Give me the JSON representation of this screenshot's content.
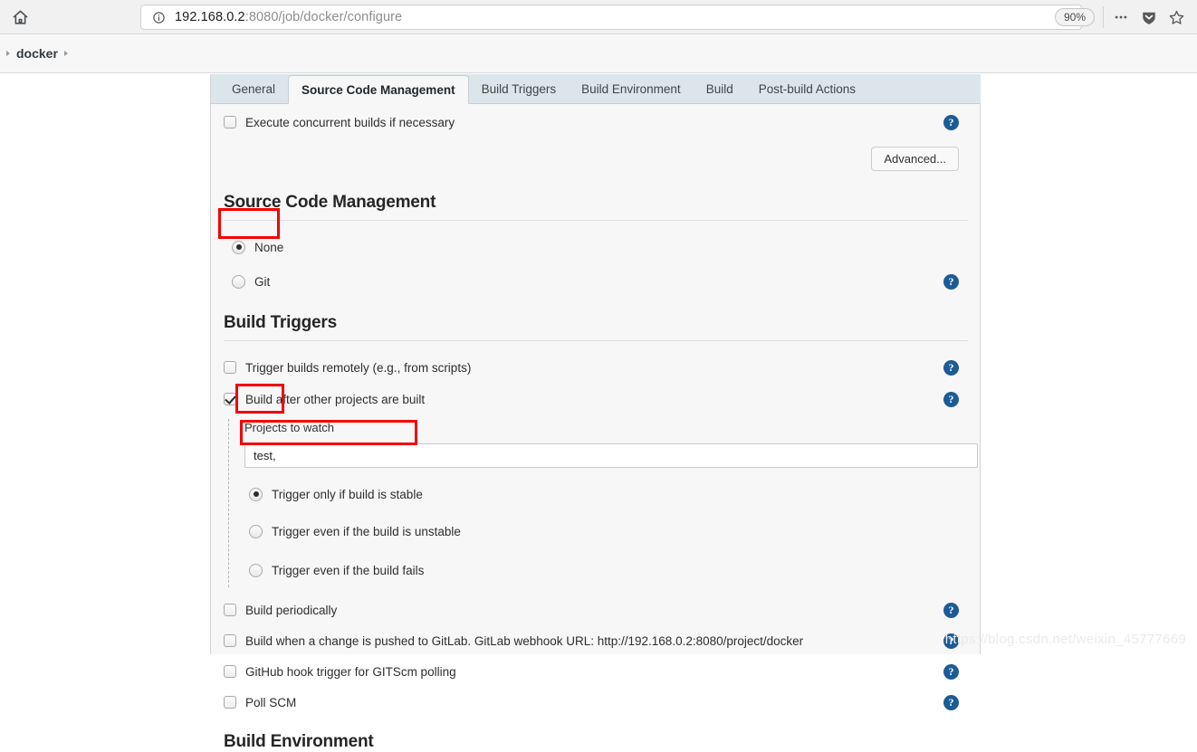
{
  "browser": {
    "home_icon": "home-icon",
    "identity_icon": "info-circle-icon",
    "url_host": "192.168.0.2",
    "url_path": ":8080/job/docker/configure",
    "zoom_level": "90%",
    "ellipsis_icon": "ellipsis-icon",
    "pocket_icon": "pocket-shield-icon",
    "star_icon": "bookmark-star-icon"
  },
  "breadcrumb": {
    "items": [
      "docker"
    ]
  },
  "tabs": [
    {
      "label": "General",
      "active": false
    },
    {
      "label": "Source Code Management",
      "active": true
    },
    {
      "label": "Build Triggers",
      "active": false
    },
    {
      "label": "Build Environment",
      "active": false
    },
    {
      "label": "Build",
      "active": false
    },
    {
      "label": "Post-build Actions",
      "active": false
    }
  ],
  "general_section": {
    "concurrent_builds": {
      "label": "Execute concurrent builds if necessary",
      "checked": false
    },
    "advanced_button": "Advanced...",
    "help_icon": "help-icon"
  },
  "scm_section": {
    "title": "Source Code Management",
    "options": [
      {
        "label": "None",
        "selected": true,
        "has_help": false
      },
      {
        "label": "Git",
        "selected": false,
        "has_help": true
      }
    ]
  },
  "build_triggers_section": {
    "title": "Build Triggers",
    "triggers": [
      {
        "label": "Trigger builds remotely (e.g., from scripts)",
        "checked": false
      },
      {
        "label": "Build after other projects are built",
        "checked": true
      }
    ],
    "projects_to_watch": {
      "label": "Projects to watch",
      "value": "test,",
      "placeholder": ""
    },
    "threshold_options": [
      {
        "label": "Trigger only if build is stable",
        "selected": true
      },
      {
        "label": "Trigger even if the build is unstable",
        "selected": false
      },
      {
        "label": "Trigger even if the build fails",
        "selected": false
      }
    ],
    "more_triggers": [
      {
        "label": "Build periodically",
        "checked": false
      },
      {
        "label": "Build when a change is pushed to GitLab. GitLab webhook URL: http://192.168.0.2:8080/project/docker",
        "checked": false
      },
      {
        "label": "GitHub hook trigger for GITScm polling",
        "checked": false
      },
      {
        "label": "Poll SCM",
        "checked": false
      }
    ]
  },
  "build_environment_section": {
    "title": "Build Environment"
  },
  "annotations": {
    "highlight_color": "#f40000",
    "boxes": [
      "scm-none-option",
      "projects-to-watch-input",
      "trigger-stable-option"
    ]
  },
  "watermark": "https://blog.csdn.net/weixin_45777669"
}
